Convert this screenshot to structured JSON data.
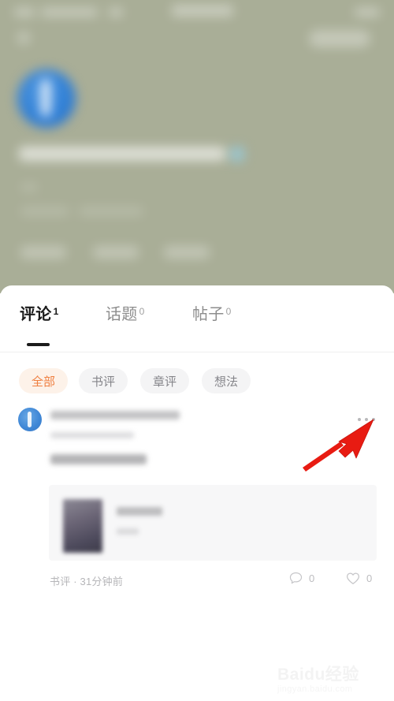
{
  "theme": {
    "background_blur_color": "#a9ae97",
    "sheet_background": "#ffffff",
    "accent_orange": "#ef7f40",
    "accent_orange_bg": "#fdf2e9",
    "chip_bg": "#f4f4f5",
    "muted_text": "#8d8d8d",
    "active_text": "#1b1b1b",
    "annotation_red": "#e81b12",
    "avatar_blue": "#3f87d6",
    "book_card_bg": "#f7f7f8"
  },
  "tabs": [
    {
      "label": "评论",
      "count": "1",
      "active": true,
      "name": "tab-comments"
    },
    {
      "label": "话题",
      "count": "0",
      "active": false,
      "name": "tab-topics"
    },
    {
      "label": "帖子",
      "count": "0",
      "active": false,
      "name": "tab-posts"
    }
  ],
  "filters": [
    {
      "label": "全部",
      "active": true
    },
    {
      "label": "书评",
      "active": false
    },
    {
      "label": "章评",
      "active": false
    },
    {
      "label": "想法",
      "active": false
    }
  ],
  "comment": {
    "more_button_label": "•••",
    "footer_meta": "书评 · 31分钟前",
    "comment_count": "0",
    "like_count": "0",
    "comment_icon": "speech-bubble-icon",
    "like_icon": "heart-icon",
    "avatar_icon": "user-avatar"
  },
  "annotation": {
    "type": "arrow",
    "color": "#e81b12",
    "points_to": "more-options-button"
  },
  "watermark": {
    "main": "Baidu经验",
    "sub": "jingyan.baidu.com"
  }
}
